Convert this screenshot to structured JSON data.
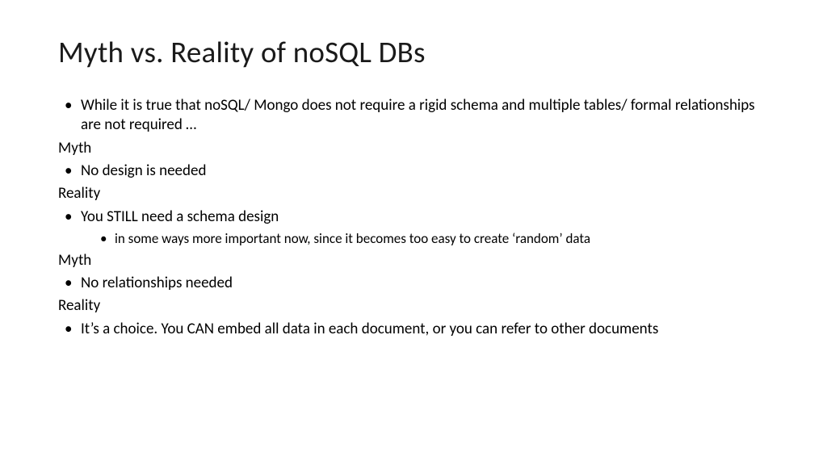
{
  "title": "Myth vs. Reality of noSQL DBs",
  "items": [
    {
      "type": "bullet-l1",
      "text": "While it is true that noSQL/ Mongo does not require a rigid schema and multiple tables/ formal relationships are not required …"
    },
    {
      "type": "label",
      "text": "Myth"
    },
    {
      "type": "bullet-l1",
      "text": "No design is needed"
    },
    {
      "type": "label",
      "text": "Reality"
    },
    {
      "type": "bullet-l1",
      "text": "You STILL need a schema design"
    },
    {
      "type": "bullet-l2",
      "text": "in some ways more important now, since it becomes too easy to create ‘random’ data"
    },
    {
      "type": "label",
      "text": "Myth"
    },
    {
      "type": "bullet-l1",
      "text": "No relationships needed"
    },
    {
      "type": "label",
      "text": "Reality"
    },
    {
      "type": "bullet-l1",
      "text": "It’s a choice.  You CAN embed all data in each document, or you can refer to other documents"
    }
  ]
}
